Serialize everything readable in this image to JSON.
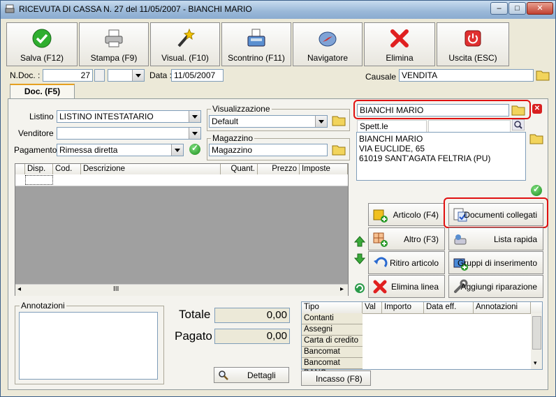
{
  "window": {
    "title": "RICEVUTA DI CASSA N. 27  del 11/05/2007  - BIANCHI MARIO",
    "controls": {
      "minimize": "–",
      "maximize": "□",
      "close": "✕"
    }
  },
  "toolbar": {
    "save": "Salva (F12)",
    "print": "Stampa (F9)",
    "preview": "Visual. (F10)",
    "receipt": "Scontrino (F11)",
    "navigator": "Navigatore",
    "delete": "Elimina",
    "exit": "Uscita (ESC)"
  },
  "header": {
    "ndoc_label": "N.Doc. :",
    "ndoc_value": "27",
    "data_label": "Data :",
    "data_value": "11/05/2007",
    "causale_label": "Causale :",
    "causale_value": "VENDITA"
  },
  "tab": {
    "label": "Doc. (F5)"
  },
  "form": {
    "listino_label": "Listino :",
    "listino_value": "LISTINO INTESTATARIO",
    "venditore_label": "Venditore :",
    "venditore_value": "",
    "pagamento_label": "Pagamento :",
    "pagamento_value": "Rimessa diretta",
    "visualizzazione_label": "Visualizzazione",
    "visualizzazione_value": "Default",
    "magazzino_label": "Magazzino",
    "magazzino_value": "Magazzino"
  },
  "customer": {
    "name": "BIANCHI MARIO",
    "salutation": "Spett.le",
    "address_lines": [
      "BIANCHI MARIO",
      "VIA EUCLIDE, 65",
      "61019 SANT'AGATA FELTRIA (PU)"
    ]
  },
  "items_grid": {
    "columns": [
      "Disp.",
      "Cod.",
      "Descrizione",
      "Quant.",
      "Prezzo",
      "Imposte"
    ],
    "scroll_thumb": "III"
  },
  "side_buttons": {
    "article": "Articolo (F4)",
    "linked_docs": "Documenti collegati",
    "other": "Altro (F3)",
    "quick_list": "Lista rapida",
    "return_article": "Ritiro articolo",
    "insert_groups": "Gruppi di inserimento",
    "delete_line": "Elimina linea",
    "add_repair": "Aggiungi riparazione"
  },
  "notes": {
    "label": "Annotazioni"
  },
  "totals": {
    "total_label": "Totale",
    "total_value": "0,00",
    "paid_label": "Pagato",
    "paid_value": "0,00",
    "details_button": "Dettagli"
  },
  "payments": {
    "columns": [
      "Tipo",
      "Val",
      "Importo",
      "Data eff.",
      "Annotazioni"
    ],
    "rows": [
      "Contanti",
      "Assegni",
      "Carta di credito",
      "Bancomat BANC.",
      "Bancomat BANC."
    ],
    "incasso_button": "Incasso (F8)"
  },
  "colors": {
    "window_bg": "#ece9d8",
    "highlight_red": "#e01010",
    "grid_area": "#a0a0a0"
  }
}
